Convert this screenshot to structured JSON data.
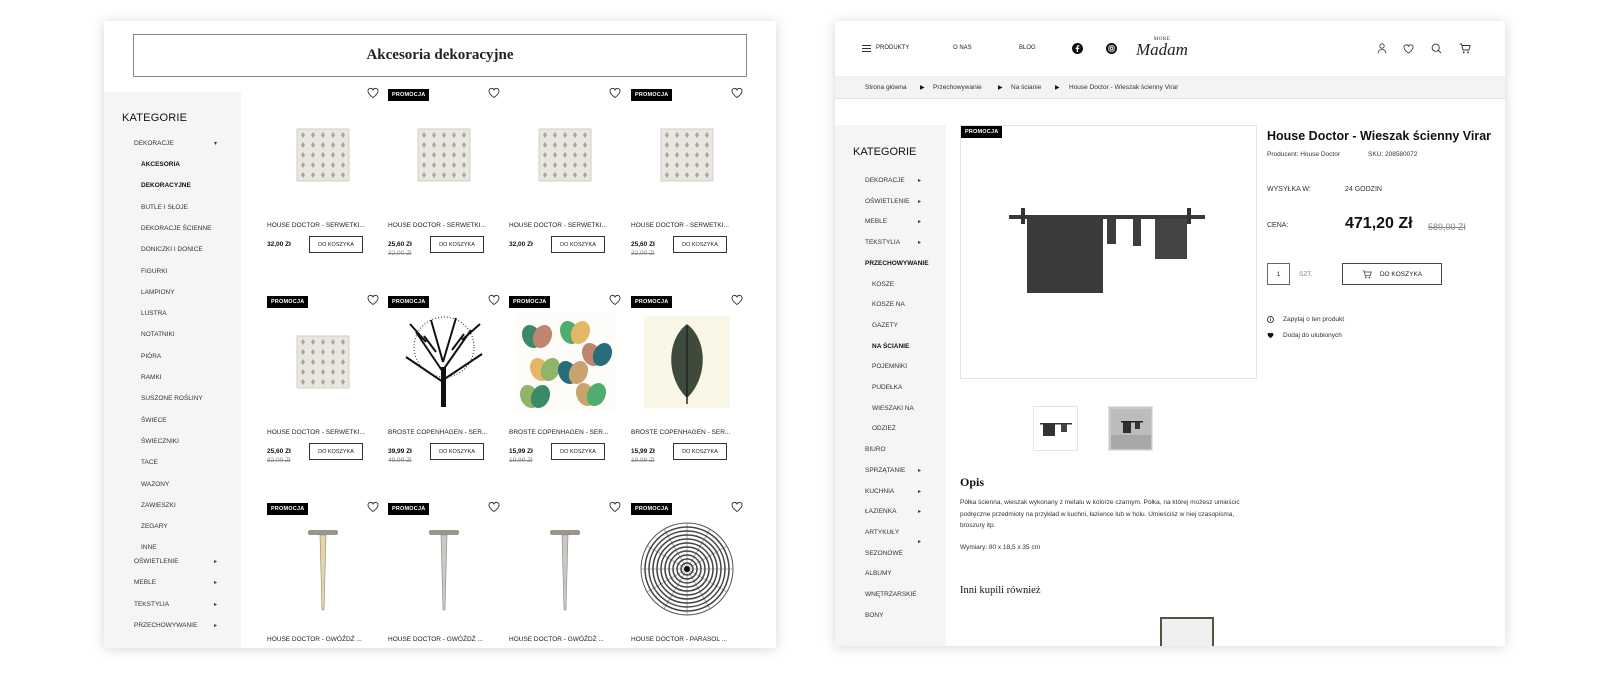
{
  "left_page": {
    "category_title": "Akcesoria dekoracyjne",
    "sidebar": {
      "heading": "KATEGORIE",
      "open_category": "DEKORACJE",
      "subcategories": [
        "AKCESORIA",
        "DEKORACYJNE",
        "BUTLE I SŁOJE",
        "DEKORACJE ŚCIENNE",
        "DONICZKI I DONICE",
        "FIGURKI",
        "LAMPIONY",
        "LUSTRA",
        "NOTATNIKI",
        "PIÓRA",
        "RAMKI",
        "SUSZONE ROŚLINY",
        "ŚWIECE",
        "ŚWIECZNIKI",
        "TACE",
        "WAZONY",
        "ZAWIESZKI",
        "ZEGARY",
        "INNE"
      ],
      "other_categories": [
        "OŚWIETLENIE",
        "MEBLE",
        "TEKSTYLIA",
        "PRZECHOWYWANIE"
      ]
    },
    "badge_label": "PROMOCJA",
    "add_to_cart_label": "DO KOSZYKA",
    "products": [
      {
        "name": "HOUSE DOCTOR - SERWETKI...",
        "price": "32,00 Zł",
        "old_price": "",
        "promo": false,
        "img": "napkin"
      },
      {
        "name": "HOUSE DOCTOR - SERWETKI...",
        "price": "25,60 Zł",
        "old_price": "32,00 Zł",
        "promo": true,
        "img": "napkin"
      },
      {
        "name": "HOUSE DOCTOR - SERWETKI...",
        "price": "32,00 Zł",
        "old_price": "",
        "promo": false,
        "img": "napkin"
      },
      {
        "name": "HOUSE DOCTOR - SERWETKI...",
        "price": "25,60 Zł",
        "old_price": "32,00 Zł",
        "promo": true,
        "img": "napkin"
      },
      {
        "name": "HOUSE DOCTOR - SERWETKI...",
        "price": "25,60 Zł",
        "old_price": "32,00 Zł",
        "promo": true,
        "img": "napkin"
      },
      {
        "name": "BROSTE COPENHAGEN - SER...",
        "price": "39,99 Zł",
        "old_price": "49,99 Zł",
        "promo": true,
        "img": "tree"
      },
      {
        "name": "BROSTE COPENHAGEN - SER...",
        "price": "15,99 Zł",
        "old_price": "19,99 Zł",
        "promo": true,
        "img": "butterflies"
      },
      {
        "name": "BROSTE COPENHAGEN - SER...",
        "price": "15,99 Zł",
        "old_price": "19,99 Zł",
        "promo": true,
        "img": "leaf"
      },
      {
        "name": "HOUSE DOCTOR - GWÓŹDŹ ...",
        "price": "",
        "old_price": "",
        "promo": true,
        "img": "nail-gold"
      },
      {
        "name": "HOUSE DOCTOR - GWÓŹDŹ ...",
        "price": "",
        "old_price": "",
        "promo": true,
        "img": "nail-silver"
      },
      {
        "name": "HOUSE DOCTOR - GWÓŹDŹ ...",
        "price": "",
        "old_price": "",
        "promo": false,
        "img": "nail-silver"
      },
      {
        "name": "HOUSE DOCTOR - PARASOL ...",
        "price": "",
        "old_price": "",
        "promo": true,
        "img": "umbrella"
      }
    ]
  },
  "right_page": {
    "nav": {
      "products": "PRODUKTY",
      "about": "O NAS",
      "blog": "BLOG"
    },
    "logo": {
      "small": "MORE",
      "script": "Madam"
    },
    "breadcrumb": [
      "Strona główna",
      "Przechowywanie",
      "Na ścianie",
      "House Doctor - Wieszak ścienny Virar"
    ],
    "sidebar": {
      "heading": "KATEGORIE",
      "items": [
        {
          "label": "DEKORACJE",
          "arrow": true,
          "bold": false,
          "indent": false
        },
        {
          "label": "OŚWIETLENIE",
          "arrow": true,
          "bold": false,
          "indent": false
        },
        {
          "label": "MEBLE",
          "arrow": true,
          "bold": false,
          "indent": false
        },
        {
          "label": "TEKSTYLIA",
          "arrow": true,
          "bold": false,
          "indent": false
        },
        {
          "label": "PRZECHOWYWANIE",
          "arrow": false,
          "bold": true,
          "indent": false
        },
        {
          "label": "KOSZE",
          "arrow": false,
          "bold": false,
          "indent": true
        },
        {
          "label": "KOSZE NA",
          "arrow": false,
          "bold": false,
          "indent": true
        },
        {
          "label": "GAZETY",
          "arrow": false,
          "bold": false,
          "indent": true
        },
        {
          "label": "NA ŚCIANIE",
          "arrow": false,
          "bold": true,
          "indent": true
        },
        {
          "label": "POJEMNIKI",
          "arrow": false,
          "bold": false,
          "indent": true
        },
        {
          "label": "PUDEŁKA",
          "arrow": false,
          "bold": false,
          "indent": true
        },
        {
          "label": "WIESZAKI NA",
          "arrow": false,
          "bold": false,
          "indent": true
        },
        {
          "label": "ODZIEŻ",
          "arrow": false,
          "bold": false,
          "indent": true
        },
        {
          "label": "BIURO",
          "arrow": false,
          "bold": false,
          "indent": false
        },
        {
          "label": "SPRZĄTANIE",
          "arrow": true,
          "bold": false,
          "indent": false
        },
        {
          "label": "KUCHNIA",
          "arrow": true,
          "bold": false,
          "indent": false
        },
        {
          "label": "ŁAZIENKA",
          "arrow": true,
          "bold": false,
          "indent": false
        },
        {
          "label": "ARTYKUŁY",
          "arrow": false,
          "bold": false,
          "indent": false
        },
        {
          "label": "SEZONOWE",
          "arrow": false,
          "bold": false,
          "indent": false
        },
        {
          "label": "ALBUMY",
          "arrow": false,
          "bold": false,
          "indent": false
        },
        {
          "label": "WNĘTRZARSKIE",
          "arrow": false,
          "bold": false,
          "indent": false
        },
        {
          "label": "BONY",
          "arrow": false,
          "bold": false,
          "indent": false
        }
      ]
    },
    "badge_label": "PROMOCJA",
    "product": {
      "title": "House Doctor - Wieszak ścienny Virar",
      "producer": "Producent: House Doctor",
      "sku": "SKU: 208580072",
      "shipping_label": "WYSYŁKA W:",
      "shipping_value": "24 GODZIN",
      "price_label": "CENA:",
      "price": "471,20 Zł",
      "old_price": "589,00 Zł",
      "qty": "1",
      "qty_unit": "SZT.",
      "add_to_cart": "DO KOSZYKA",
      "ask": "Zapytaj o ten produkt",
      "fav": "Dodaj do ulubionych"
    },
    "description": {
      "heading": "Opis",
      "text": "Półka ścienna, wieszak wykonany z metalu w kolorze czarnym. Półka, na której możesz umieścić podręczne przedmioty na przykład w kuchni, łazience lub w holu. Umieściśz w niej czasopisma, broszury itp.",
      "dimensions": "Wymiary: 80 x 18,5 x 35 cm"
    },
    "also_bought": "Inni kupili również"
  }
}
